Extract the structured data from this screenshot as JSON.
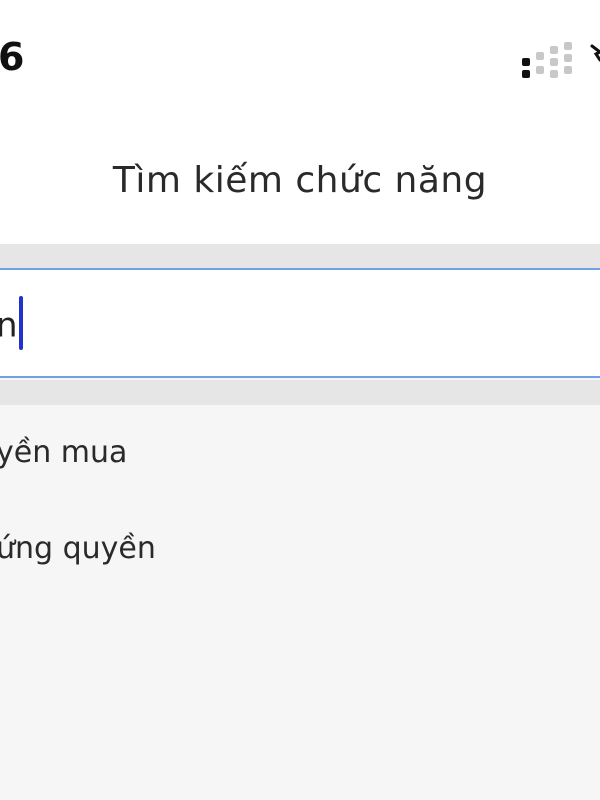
{
  "status_bar": {
    "time": "6",
    "signal_icon": "signal-strength-icon",
    "extra_icon": "battery-icon"
  },
  "header": {
    "title": "Tìm kiếm chức năng"
  },
  "search": {
    "value": "n",
    "accent_color": "#6fa2e4",
    "caret_color": "#2233cc"
  },
  "results": {
    "items": [
      {
        "label": "yền mua"
      },
      {
        "label": "ứng quyền"
      }
    ]
  }
}
